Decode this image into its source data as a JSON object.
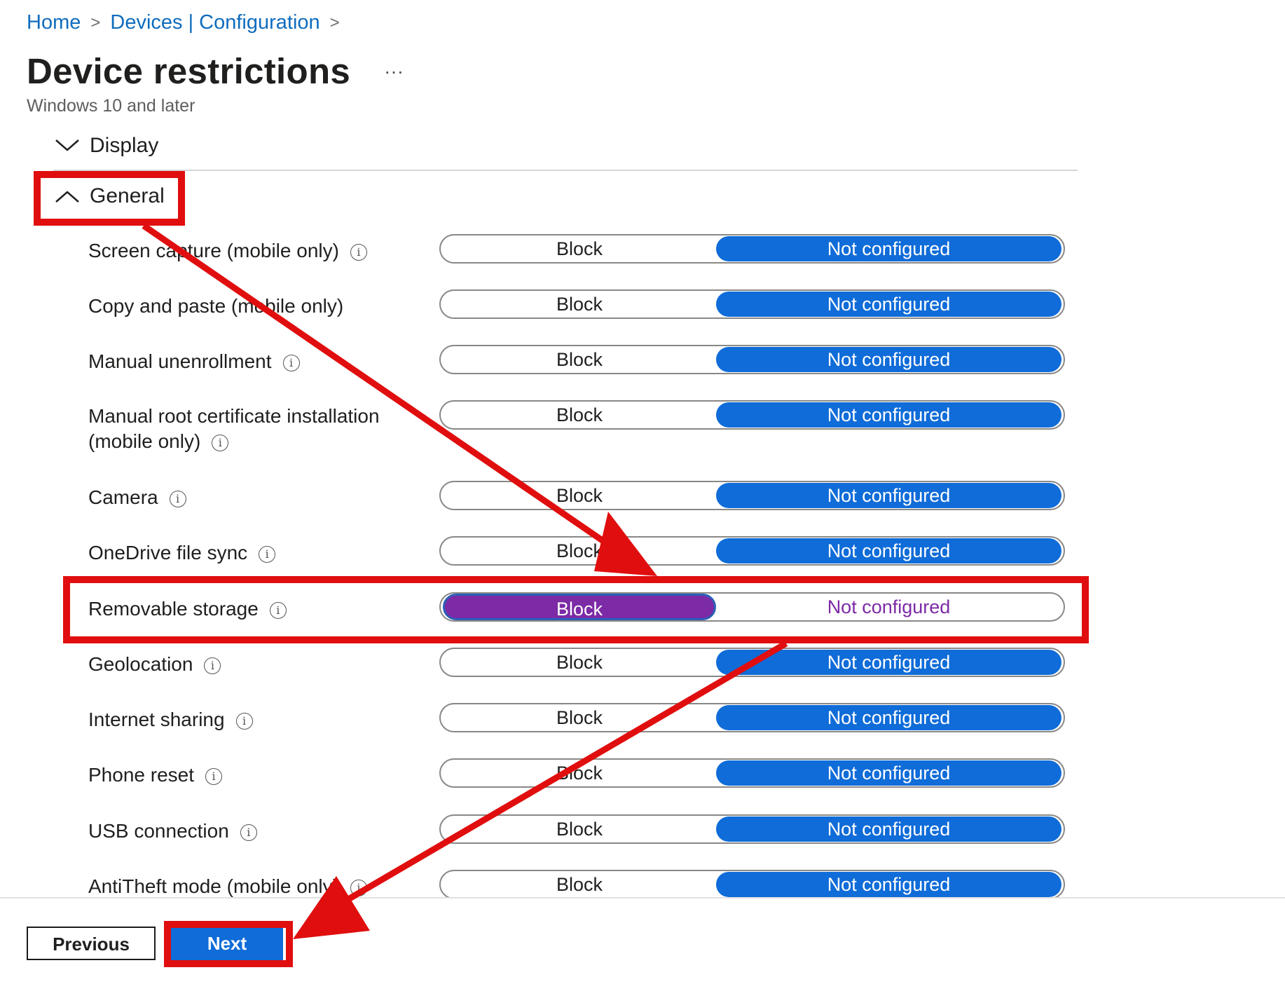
{
  "breadcrumb": {
    "home": "Home",
    "separator": ">",
    "section": "Devices | Configuration"
  },
  "header": {
    "title": "Device restrictions",
    "more": "···",
    "subtitle": "Windows 10 and later"
  },
  "sections": {
    "display": "Display",
    "general": "General"
  },
  "settings": [
    {
      "label": "Screen capture (mobile only)",
      "option_block": "Block",
      "option_not_configured": "Not configured",
      "selected": "Not configured"
    },
    {
      "label": "Copy and paste (mobile only)",
      "option_block": "Block",
      "option_not_configured": "Not configured",
      "selected": "Not configured"
    },
    {
      "label": "Manual unenrollment",
      "option_block": "Block",
      "option_not_configured": "Not configured",
      "selected": "Not configured"
    },
    {
      "label": "Manual root certificate installation",
      "label_line2": "(mobile only)",
      "option_block": "Block",
      "option_not_configured": "Not configured",
      "selected": "Not configured"
    },
    {
      "label": "Camera",
      "option_block": "Block",
      "option_not_configured": "Not configured",
      "selected": "Not configured"
    },
    {
      "label": "OneDrive file sync",
      "option_block": "Block",
      "option_not_configured": "Not configured",
      "selected": "Not configured"
    },
    {
      "label": "Removable storage",
      "option_block": "Block",
      "option_not_configured": "Not configured",
      "selected": "Block"
    },
    {
      "label": "Geolocation",
      "option_block": "Block",
      "option_not_configured": "Not configured",
      "selected": "Not configured"
    },
    {
      "label": "Internet sharing",
      "option_block": "Block",
      "option_not_configured": "Not configured",
      "selected": "Not configured"
    },
    {
      "label": "Phone reset",
      "option_block": "Block",
      "option_not_configured": "Not configured",
      "selected": "Not configured"
    },
    {
      "label": "USB connection",
      "option_block": "Block",
      "option_not_configured": "Not configured",
      "selected": "Not configured"
    },
    {
      "label": "AntiTheft mode (mobile only)",
      "option_block": "Block",
      "option_not_configured": "Not configured",
      "selected": "Not configured"
    }
  ],
  "footer": {
    "previous": "Previous",
    "next": "Next"
  },
  "info_icon_glyph": "i",
  "colors": {
    "accent": "#0f6cd8",
    "selected_block": "#7c2aa6",
    "annotation": "#e00e0e"
  }
}
